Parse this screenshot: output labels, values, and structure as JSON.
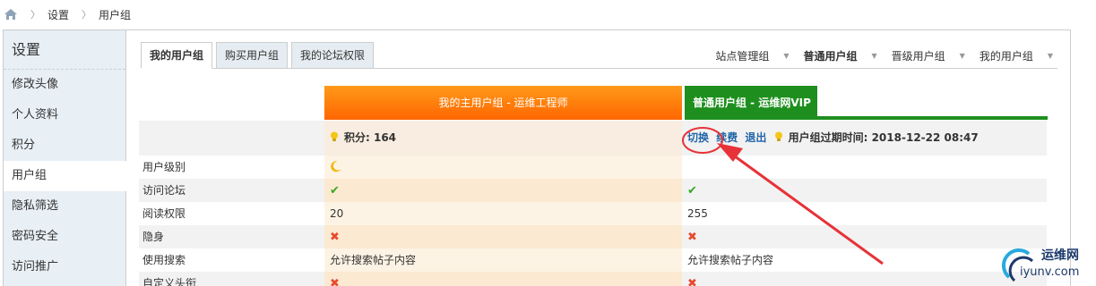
{
  "breadcrumb": {
    "items": [
      "设置",
      "用户组"
    ]
  },
  "sidebar": {
    "title": "设置",
    "items": [
      "修改头像",
      "个人资料",
      "积分",
      "用户组",
      "隐私筛选",
      "密码安全",
      "访问推广"
    ],
    "active_index": 3
  },
  "tabs": [
    "我的用户组",
    "购买用户组",
    "我的论坛权限"
  ],
  "group_nav": [
    "站点管理组",
    "普通用户组",
    "晋级用户组",
    "我的用户组"
  ],
  "columns": {
    "main": "我的主用户组 - 运维工程师",
    "vip": "普通用户组 - 运维网VIP"
  },
  "info_row": {
    "points": "积分: 164",
    "actions": [
      "切换",
      "续费",
      "退出"
    ],
    "expiry": "用户组过期时间: 2018-12-22 08:47"
  },
  "rows": [
    {
      "label": "用户级别",
      "main": "moon",
      "vip": ""
    },
    {
      "label": "访问论坛",
      "main": "check",
      "vip": "check"
    },
    {
      "label": "阅读权限",
      "main": "20",
      "vip": "255"
    },
    {
      "label": "隐身",
      "main": "cross",
      "vip": "cross"
    },
    {
      "label": "使用搜索",
      "main": "允许搜索帖子内容",
      "vip": "允许搜索帖子内容"
    },
    {
      "label": "自定义头衔",
      "main": "cross",
      "vip": "cross"
    }
  ],
  "watermark": {
    "cn": "运维网",
    "en": "iyunv.com"
  },
  "colors": {
    "orange": "#ff7a0d",
    "green": "#1e8f1e",
    "annotation_red": "#e63238",
    "link": "#2366a8"
  }
}
